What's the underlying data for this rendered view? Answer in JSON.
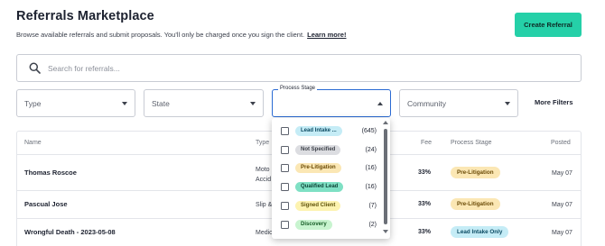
{
  "header": {
    "title": "Referrals Marketplace",
    "subtitle": "Browse available referrals and submit proposals. You'll only be charged once you sign the client.",
    "learn_more": "Learn more!",
    "create_button": "Create Referral"
  },
  "search": {
    "placeholder": "Search for referrals..."
  },
  "filters": {
    "type": "Type",
    "state": "State",
    "process_stage_label": "Process Stage",
    "community": "Community",
    "more_filters": "More Filters"
  },
  "table": {
    "headers": {
      "name": "Name",
      "type": "Type",
      "fee": "Fee",
      "stage": "Process Stage",
      "posted": "Posted"
    },
    "rows": [
      {
        "name": "Thomas Roscoe",
        "type_line1": "Moto",
        "type_line2": "Accid",
        "fee": "33%",
        "stage": "Pre-Litigation",
        "posted": "May 07"
      },
      {
        "name": "Pascual Jose",
        "type_line1": "Slip &",
        "type_line2": "",
        "fee": "33%",
        "stage": "Pre-Litigation",
        "posted": "May 07"
      },
      {
        "name": "Wrongful Death - 2023-05-08",
        "type_line1": "Medic",
        "type_line2": "",
        "fee": "33%",
        "stage": "Lead Intake Only",
        "posted": "May 07"
      }
    ]
  },
  "dropdown": {
    "options": [
      {
        "label": "Lead Intake ...",
        "count": "(645)",
        "color": "#c5ecf6"
      },
      {
        "label": "Not Specified",
        "count": "(24)",
        "color": "#dcdde1"
      },
      {
        "label": "Pre-Litigation",
        "count": "(16)",
        "color": "#fbe7b4"
      },
      {
        "label": "Qualified Lead",
        "count": "(16)",
        "color": "#7fe0c4"
      },
      {
        "label": "Signed Client",
        "count": "(7)",
        "color": "#fdf3b0"
      },
      {
        "label": "Discovery",
        "count": "(2)",
        "color": "#c8f4cf"
      }
    ]
  },
  "colors": {
    "accent": "#25d0a8",
    "focus_border": "#2a6ad3",
    "pre_litigation": "#fbe7b4",
    "lead_intake": "#c5ecf6"
  }
}
